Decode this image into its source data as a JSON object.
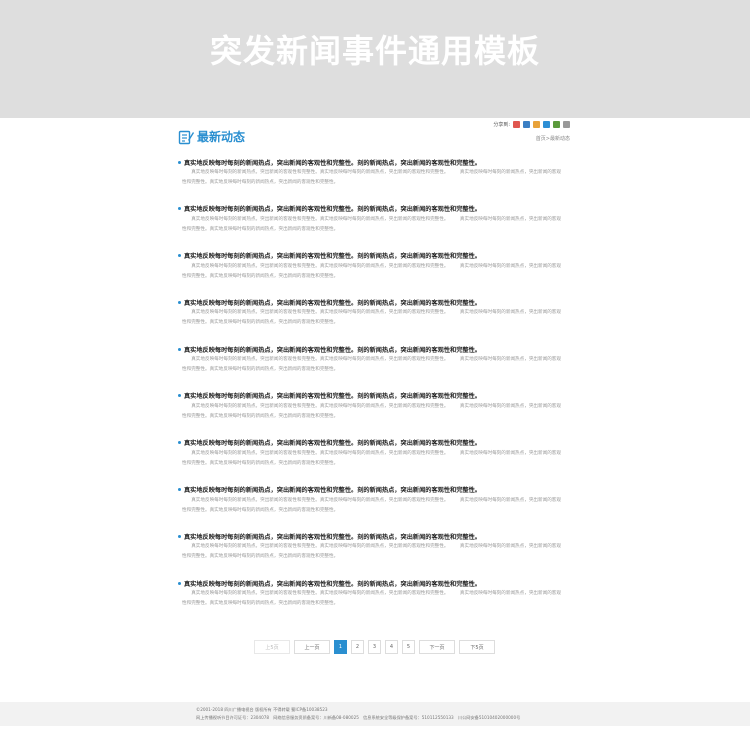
{
  "hero": {
    "title": "突发新闻事件通用模板"
  },
  "share": {
    "label": "分享到:",
    "icons": [
      "qzone-icon",
      "tencent-weibo-icon",
      "sina-weibo-icon",
      "renren-icon",
      "douban-icon",
      "more-share-icon"
    ],
    "colors": [
      "#e0574f",
      "#3b7fc4",
      "#e8a23a",
      "#2d8fd5",
      "#5b9a3c",
      "#999999"
    ]
  },
  "section": {
    "title": "最新动态",
    "accent": "#2a8fd0"
  },
  "breadcrumb": "首页>最新动态",
  "news": {
    "items": [
      {
        "title": "真实地反映每时每刻的新闻热点，突出新闻的客观性和完整性。刻的新闻热点，突出新闻的客观性和完整性。",
        "body": "真实地反映每时每刻的新闻热点。突出新闻的客观性和完整性。真实地反映每时每刻的新闻热点，突出新闻的客观性和完整性。　　　真实地反映每时每刻的新闻热点，突出新闻的客观性和完整性。真实地反映每时每刻的新闻热点，突出新闻的客观性和完整性。"
      },
      {
        "title": "真实地反映每时每刻的新闻热点，突出新闻的客观性和完整性。刻的新闻热点，突出新闻的客观性和完整性。",
        "body": "真实地反映每时每刻的新闻热点。突出新闻的客观性和完整性。真实地反映每时每刻的新闻热点，突出新闻的客观性和完整性。　　　真实地反映每时每刻的新闻热点，突出新闻的客观性和完整性。真实地反映每时每刻的新闻热点，突出新闻的客观性和完整性。"
      },
      {
        "title": "真实地反映每时每刻的新闻热点，突出新闻的客观性和完整性。刻的新闻热点，突出新闻的客观性和完整性。",
        "body": "真实地反映每时每刻的新闻热点。突出新闻的客观性和完整性。真实地反映每时每刻的新闻热点，突出新闻的客观性和完整性。　　　真实地反映每时每刻的新闻热点，突出新闻的客观性和完整性。真实地反映每时每刻的新闻热点，突出新闻的客观性和完整性。"
      },
      {
        "title": "真实地反映每时每刻的新闻热点，突出新闻的客观性和完整性。刻的新闻热点，突出新闻的客观性和完整性。",
        "body": "真实地反映每时每刻的新闻热点。突出新闻的客观性和完整性。真实地反映每时每刻的新闻热点，突出新闻的客观性和完整性。　　　真实地反映每时每刻的新闻热点，突出新闻的客观性和完整性。真实地反映每时每刻的新闻热点，突出新闻的客观性和完整性。"
      },
      {
        "title": "真实地反映每时每刻的新闻热点，突出新闻的客观性和完整性。刻的新闻热点，突出新闻的客观性和完整性。",
        "body": "真实地反映每时每刻的新闻热点。突出新闻的客观性和完整性。真实地反映每时每刻的新闻热点，突出新闻的客观性和完整性。　　　真实地反映每时每刻的新闻热点，突出新闻的客观性和完整性。真实地反映每时每刻的新闻热点，突出新闻的客观性和完整性。"
      },
      {
        "title": "真实地反映每时每刻的新闻热点，突出新闻的客观性和完整性。刻的新闻热点，突出新闻的客观性和完整性。",
        "body": "真实地反映每时每刻的新闻热点。突出新闻的客观性和完整性。真实地反映每时每刻的新闻热点，突出新闻的客观性和完整性。　　　真实地反映每时每刻的新闻热点，突出新闻的客观性和完整性。真实地反映每时每刻的新闻热点，突出新闻的客观性和完整性。"
      },
      {
        "title": "真实地反映每时每刻的新闻热点，突出新闻的客观性和完整性。刻的新闻热点，突出新闻的客观性和完整性。",
        "body": "真实地反映每时每刻的新闻热点。突出新闻的客观性和完整性。真实地反映每时每刻的新闻热点，突出新闻的客观性和完整性。　　　真实地反映每时每刻的新闻热点，突出新闻的客观性和完整性。真实地反映每时每刻的新闻热点，突出新闻的客观性和完整性。"
      },
      {
        "title": "真实地反映每时每刻的新闻热点，突出新闻的客观性和完整性。刻的新闻热点，突出新闻的客观性和完整性。",
        "body": "真实地反映每时每刻的新闻热点。突出新闻的客观性和完整性。真实地反映每时每刻的新闻热点，突出新闻的客观性和完整性。　　　真实地反映每时每刻的新闻热点，突出新闻的客观性和完整性。真实地反映每时每刻的新闻热点，突出新闻的客观性和完整性。"
      },
      {
        "title": "真实地反映每时每刻的新闻热点，突出新闻的客观性和完整性。刻的新闻热点，突出新闻的客观性和完整性。",
        "body": "真实地反映每时每刻的新闻热点。突出新闻的客观性和完整性。真实地反映每时每刻的新闻热点，突出新闻的客观性和完整性。　　　真实地反映每时每刻的新闻热点，突出新闻的客观性和完整性。真实地反映每时每刻的新闻热点，突出新闻的客观性和完整性。"
      },
      {
        "title": "真实地反映每时每刻的新闻热点，突出新闻的客观性和完整性。刻的新闻热点，突出新闻的客观性和完整性。",
        "body": "真实地反映每时每刻的新闻热点。突出新闻的客观性和完整性。真实地反映每时每刻的新闻热点，突出新闻的客观性和完整性。　　　真实地反映每时每刻的新闻热点，突出新闻的客观性和完整性。真实地反映每时每刻的新闻热点，突出新闻的客观性和完整性。"
      }
    ]
  },
  "pager": {
    "first": "上5页",
    "prev": "上一页",
    "pages": [
      "1",
      "2",
      "3",
      "4",
      "5"
    ],
    "current": "1",
    "next": "下一页",
    "last": "下5页"
  },
  "footer": {
    "line1": "©2001-2018 四川广播电视台 版权所有 不得转载  蜀ICP备10038523",
    "line2": "网上传播视听节目许可证号：2304078　网络信息服务资质备案号：川新备08-080025　信息系统安全等级保护备案号：510112550133　川公网安备51010402000000号"
  }
}
